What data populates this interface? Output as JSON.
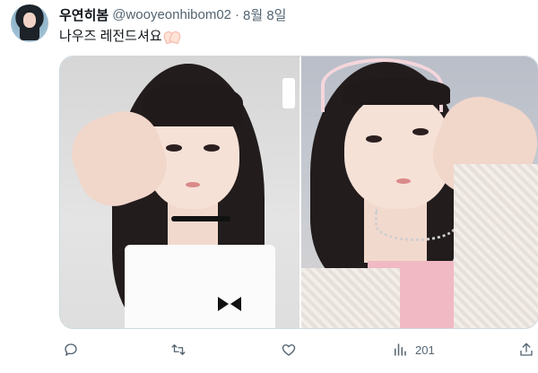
{
  "author": {
    "display_name": "우연히봄",
    "handle": "@wooyeonhibom02",
    "separator": "·",
    "date": "8월 8일"
  },
  "tweet": {
    "text": "나우즈 레전드셔요",
    "emoji": "heart-hands"
  },
  "media": {
    "photo_count": 2
  },
  "actions": {
    "reply_icon": "reply-icon",
    "retweet_icon": "retweet-icon",
    "like_icon": "heart-icon",
    "views_icon": "views-icon",
    "views_count": "201",
    "share_icon": "share-icon"
  },
  "colors": {
    "text_primary": "#0f1419",
    "text_secondary": "#536471",
    "border": "#cfd9de"
  }
}
